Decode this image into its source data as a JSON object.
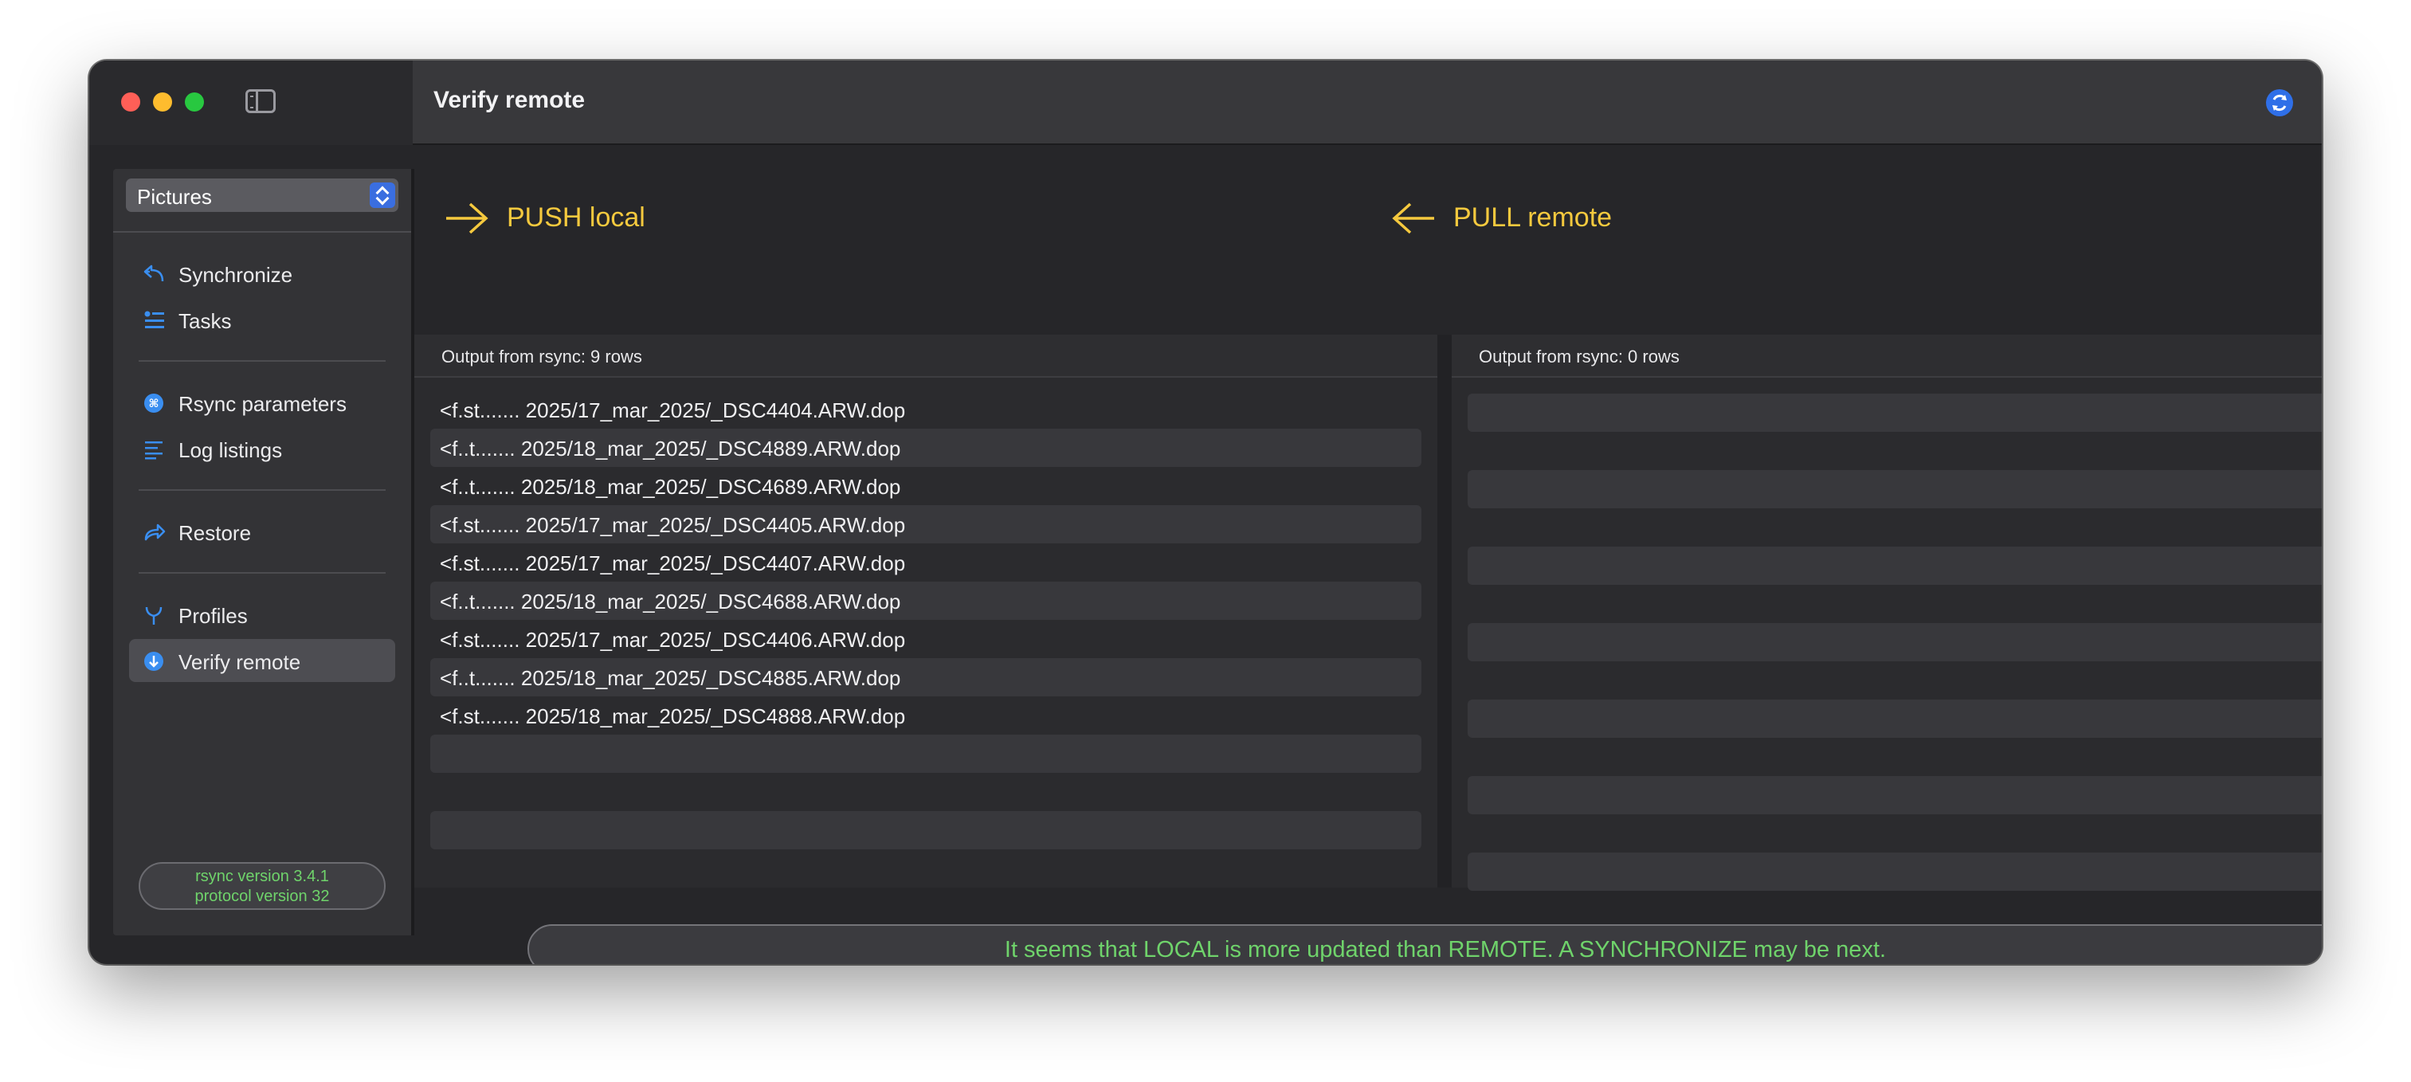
{
  "window": {
    "title": "Verify remote"
  },
  "sidebar": {
    "profile_selected": "Pictures",
    "groups": [
      [
        {
          "label": "Synchronize",
          "icon": "synchronize-icon"
        },
        {
          "label": "Tasks",
          "icon": "tasks-icon"
        }
      ],
      [
        {
          "label": "Rsync parameters",
          "icon": "rsync-parameters-icon"
        },
        {
          "label": "Log listings",
          "icon": "log-listings-icon"
        }
      ],
      [
        {
          "label": "Restore",
          "icon": "restore-icon"
        }
      ],
      [
        {
          "label": "Profiles",
          "icon": "profiles-icon"
        },
        {
          "label": "Verify remote",
          "icon": "verify-remote-icon",
          "selected": true
        }
      ]
    ],
    "version_line1": "rsync  version 3.4.1",
    "version_line2": "protocol version 32"
  },
  "push": {
    "title": "PUSH local",
    "output_header": "Output from rsync: 9 rows",
    "rows": [
      "<f.st....... 2025/17_mar_2025/_DSC4404.ARW.dop",
      "<f..t....... 2025/18_mar_2025/_DSC4889.ARW.dop",
      "<f..t....... 2025/18_mar_2025/_DSC4689.ARW.dop",
      "<f.st....... 2025/17_mar_2025/_DSC4405.ARW.dop",
      "<f.st....... 2025/17_mar_2025/_DSC4407.ARW.dop",
      "<f..t....... 2025/18_mar_2025/_DSC4688.ARW.dop",
      "<f.st....... 2025/17_mar_2025/_DSC4406.ARW.dop",
      "<f..t....... 2025/18_mar_2025/_DSC4885.ARW.dop",
      "<f.st....... 2025/18_mar_2025/_DSC4888.ARW.dop"
    ]
  },
  "pull": {
    "title": "PULL remote",
    "output_header": "Output from rsync: 0 rows",
    "rows": []
  },
  "status_message": "It seems that LOCAL is more updated than REMOTE. A SYNCHRONIZE may be next.",
  "colors": {
    "accent_yellow": "#f5c93e",
    "status_green": "#6fd36b",
    "icon_blue": "#3a8ef0"
  }
}
